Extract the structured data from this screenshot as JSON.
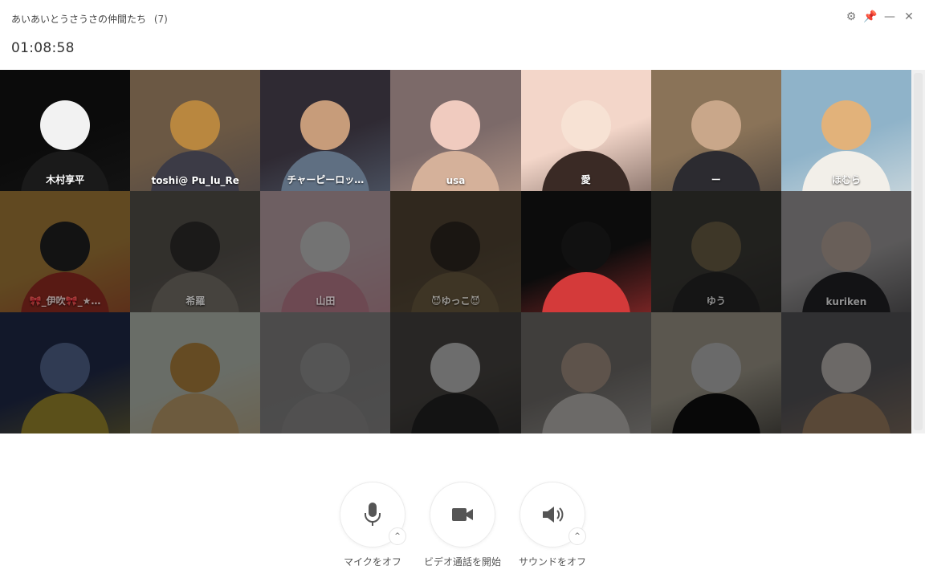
{
  "window": {
    "title": "あいあいとうさうさの仲間たち",
    "member_count": "(7)",
    "elapsed": "01:08:58",
    "controls": [
      "settings-icon",
      "pin-icon",
      "minimize-icon",
      "close-icon"
    ]
  },
  "participants": [
    {
      "name": "木村享平",
      "state": "active",
      "bg": "#0b0b0b",
      "head": "#f2f2f2",
      "body": "#1a1a1a"
    },
    {
      "name": "toshi@ Pu_lu_Re",
      "state": "active",
      "bg": "#6b5844",
      "head": "#b9873f",
      "body": "#3c3b46"
    },
    {
      "name": "チャーピーロッ…",
      "state": "active",
      "bg": "#2f2a33",
      "head": "#c79c7a",
      "body": "#5f6f82"
    },
    {
      "name": "usa",
      "state": "active",
      "bg": "#7c6a69",
      "head": "#f0cbbf",
      "body": "#d5b19a"
    },
    {
      "name": "愛",
      "state": "active",
      "bg": "#f3d6c9",
      "head": "#f7e2d4",
      "body": "#3a2a25"
    },
    {
      "name": "ー",
      "state": "active",
      "bg": "#8a7358",
      "head": "#c9a78a",
      "body": "#2c2b30"
    },
    {
      "name": "ほむら",
      "state": "active",
      "bg": "#8fb3c9",
      "head": "#e2b27a",
      "body": "#f2efe9"
    },
    {
      "name": "🎀_伊吹🎀_★…",
      "state": "muted",
      "bg": "#d8a24a",
      "head": "#2b2b2b",
      "body": "#c33a2e"
    },
    {
      "name": "希羅",
      "state": "muted",
      "bg": "#6f6a63",
      "head": "#3c3a38",
      "body": "#9c948a"
    },
    {
      "name": "山田",
      "state": "muted",
      "bg": "#f3d2da",
      "head": "#ffffff",
      "body": "#f2a3b6"
    },
    {
      "name": "😈ゆっこ😈",
      "state": "muted",
      "bg": "#6b5a44",
      "head": "#3b3229",
      "body": "#8a7552"
    },
    {
      "name": "",
      "state": "active",
      "bg": "#0c0c0c",
      "head": "#111111",
      "body": "#d43a3a"
    },
    {
      "name": "ゆう",
      "state": "muted",
      "bg": "#4b4a44",
      "head": "#8a7a5a",
      "body": "#2f2f2f"
    },
    {
      "name": "kuriken",
      "state": "muted",
      "bg": "#c9c6c7",
      "head": "#e9d3c6",
      "body": "#2a2a2f"
    },
    {
      "name": "",
      "state": "muted",
      "bg": "#28355e",
      "head": "#6c84b8",
      "body": "#c9b23a"
    },
    {
      "name": "",
      "state": "muted",
      "bg": "#e9f2e4",
      "head": "#e1a64e",
      "body": "#f1c98b"
    },
    {
      "name": "",
      "state": "muted",
      "bg": "#a8a7a7",
      "head": "#bdbcbc",
      "body": "#b3b2b2"
    },
    {
      "name": "",
      "state": "muted",
      "bg": "#5a5652",
      "head": "#f1f1f1",
      "body": "#2a2a2a"
    },
    {
      "name": "",
      "state": "muted",
      "bg": "#8e8a86",
      "head": "#d0b9a7",
      "body": "#f0ece6"
    },
    {
      "name": "",
      "state": "muted",
      "bg": "#c9c2b0",
      "head": "#ececec",
      "body": "#121212"
    },
    {
      "name": "",
      "state": "muted",
      "bg": "#6c6b70",
      "head": "#efe9e4",
      "body": "#c6a07b"
    }
  ],
  "controls": {
    "mic": {
      "label": "マイクをオフ",
      "icon": "microphone-icon"
    },
    "video": {
      "label": "ビデオ通話を開始",
      "icon": "video-camera-icon"
    },
    "sound": {
      "label": "サウンドをオフ",
      "icon": "speaker-icon"
    }
  }
}
